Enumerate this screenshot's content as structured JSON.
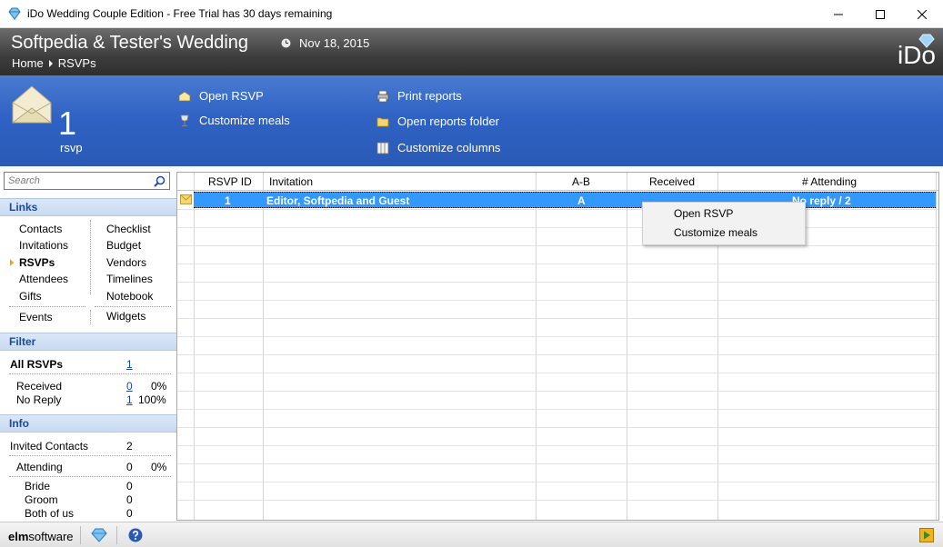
{
  "window": {
    "title": "iDo Wedding Couple Edition - Free Trial has 30 days remaining"
  },
  "header": {
    "wedding_title": "Softpedia & Tester's Wedding",
    "date": "Nov 18, 2015",
    "breadcrumb": [
      "Home",
      "RSVPs"
    ],
    "logo": "iDo"
  },
  "actionbar": {
    "count": "1",
    "count_label": "rsvp",
    "actions": {
      "open_rsvp": "Open RSVP",
      "customize_meals": "Customize meals",
      "print_reports": "Print reports",
      "open_reports_folder": "Open reports folder",
      "customize_columns": "Customize columns"
    }
  },
  "sidebar": {
    "search_placeholder": "Search",
    "links_title": "Links",
    "links_left": [
      "Contacts",
      "Invitations",
      "RSVPs",
      "Attendees",
      "Gifts",
      "Events"
    ],
    "links_right": [
      "Checklist",
      "Budget",
      "Vendors",
      "Timelines",
      "Notebook",
      "Widgets"
    ],
    "active_link": "RSVPs",
    "filter_title": "Filter",
    "filter": {
      "all_label": "All RSVPs",
      "all_count": "1",
      "received_label": "Received",
      "received_count": "0",
      "received_pct": "0%",
      "noreply_label": "No Reply",
      "noreply_count": "1",
      "noreply_pct": "100%"
    },
    "info_title": "Info",
    "info": {
      "invited_label": "Invited Contacts",
      "invited_value": "2",
      "attending_label": "Attending",
      "attending_value": "0",
      "attending_pct": "0%",
      "bride_label": "Bride",
      "bride_value": "0",
      "groom_label": "Groom",
      "groom_value": "0",
      "both_label": "Both of us",
      "both_value": "0"
    }
  },
  "grid": {
    "columns": [
      "RSVP ID",
      "Invitation",
      "A-B",
      "Received",
      "# Attending"
    ],
    "rows": [
      {
        "id": "1",
        "invitation": "Editor, Softpedia and Guest",
        "ab": "A",
        "received": "",
        "attending": "No reply / 2"
      }
    ]
  },
  "context_menu": {
    "items": [
      "Open RSVP",
      "Customize meals"
    ]
  },
  "statusbar": {
    "brand_bold": "elm",
    "brand_rest": "software"
  },
  "colors": {
    "header_dark": "#3d3d3d",
    "action_blue": "#2f62c4",
    "selection_blue": "#3399ff",
    "section_text": "#1a4a9a"
  }
}
